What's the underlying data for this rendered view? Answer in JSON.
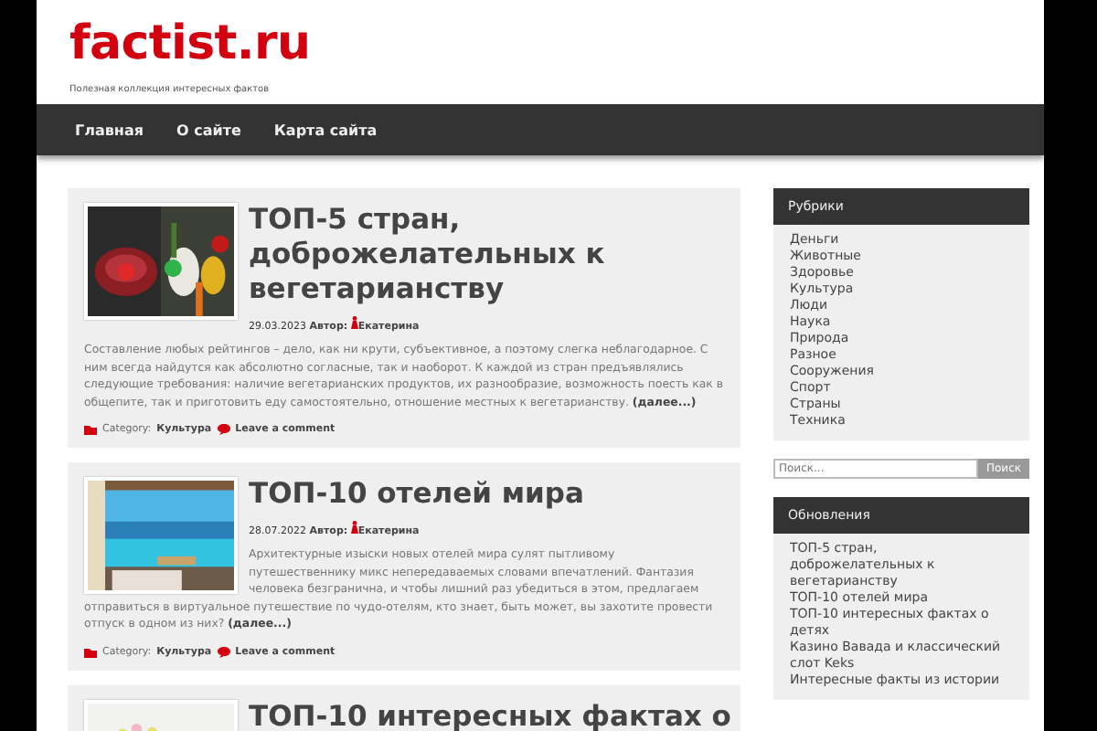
{
  "site": {
    "title": "factist.ru",
    "tagline": "Полезная коллекция интересных фактов"
  },
  "nav": [
    "Главная",
    "О сайте",
    "Карта сайта"
  ],
  "posts": [
    {
      "title": "ТОП-5 стран, доброжелательных к вегетарианству",
      "date": "29.03.2023",
      "author_label": "Автор:",
      "author": "Екатерина",
      "excerpt": "Составление любых рейтингов – дело, как ни крути, субъективное, а поэтому слегка неблагодарное. С ним всегда найдутся как абсолютно согласные, так и наоборот. К каждой из стран предъявлялись следующие требования: наличие вегетарианских продуктов, их разнообразие, возможность поесть как в общепите, так и приготовить еду самостоятельно, отношение местных к вегетарианству.",
      "more": "(далее...)",
      "category_label": "Category:",
      "category": "Культура",
      "comment": "Leave a comment"
    },
    {
      "title": "ТОП-10 отелей мира",
      "date": "28.07.2022",
      "author_label": "Автор:",
      "author": "Екатерина",
      "excerpt": "Архитектурные изыски новых отелей мира сулят пытливому путешественнику микс непередаваемых словами впечатлений. Фантазия человека безгранична, и чтобы лишний раз убедиться в этом, предлагаем отправиться в виртуальное путешествие по чудо-отелям, кто знает, быть может, вы захотите провести отпуск в одном из них?",
      "more": "(далее...)",
      "category_label": "Category:",
      "category": "Культура",
      "comment": "Leave a comment"
    },
    {
      "title": "ТОП-10 интересных фактах о"
    }
  ],
  "sidebar": {
    "categories": {
      "title": "Рубрики",
      "items": [
        "Деньги",
        "Животные",
        "Здоровье",
        "Культура",
        "Люди",
        "Наука",
        "Природа",
        "Разное",
        "Сооружения",
        "Спорт",
        "Страны",
        "Техника"
      ]
    },
    "search": {
      "placeholder": "Поиск...",
      "button": "Поиск"
    },
    "updates": {
      "title": "Обновления",
      "items": [
        "ТОП-5 стран, доброжелательных к вегетарианству",
        "ТОП-10 отелей мира",
        "ТОП-10 интересных фактах о детях",
        "Казино Вавада и классический слот Keks",
        "Интересные факты из истории"
      ]
    }
  }
}
